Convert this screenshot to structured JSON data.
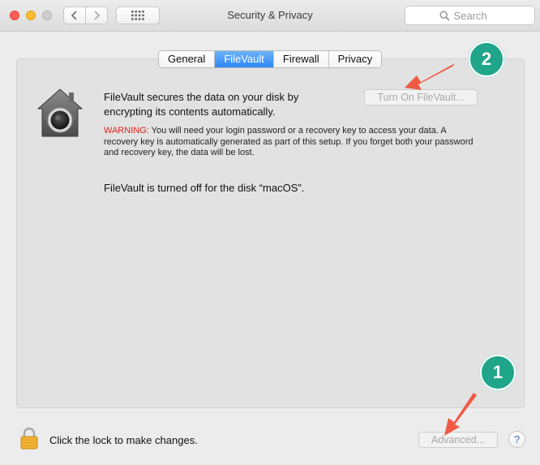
{
  "window": {
    "title": "Security & Privacy",
    "search_placeholder": "Search"
  },
  "tabs": [
    {
      "label": "General",
      "active": false
    },
    {
      "label": "FileVault",
      "active": true
    },
    {
      "label": "Firewall",
      "active": false
    },
    {
      "label": "Privacy",
      "active": false
    }
  ],
  "filevault": {
    "description": "FileVault secures the data on your disk by encrypting its contents automatically.",
    "turn_on_label": "Turn On FileVault...",
    "warning_label": "WARNING:",
    "warning_text": " You will need your login password or a recovery key to access your data. A recovery key is automatically generated as part of this setup. If you forget both your password and recovery key, the data will be lost.",
    "status": "FileVault is turned off for the disk “macOS”."
  },
  "footer": {
    "lock_text": "Click the lock to make changes.",
    "advanced_label": "Advanced...",
    "help_label": "?"
  },
  "annotations": {
    "badge_1": "1",
    "badge_2": "2"
  },
  "colors": {
    "accent_tab": "#2e86f5",
    "warning": "#e0201b",
    "badge": "#1fa58a",
    "arrow": "#ef5a45"
  },
  "icons": [
    "back-chevron-icon",
    "forward-chevron-icon",
    "grid-icon",
    "search-icon",
    "filevault-house-icon",
    "lock-icon"
  ]
}
